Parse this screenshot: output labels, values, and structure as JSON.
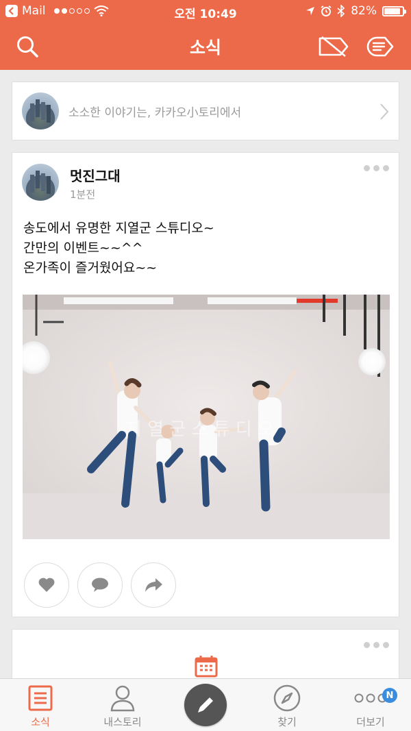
{
  "status_bar": {
    "back_app": "Mail",
    "time": "오전 10:49",
    "battery": "82%",
    "battery_level": 0.82
  },
  "header": {
    "title": "소식"
  },
  "compose": {
    "prompt": "소소한 이야기는, 카카오小토리에서"
  },
  "post": {
    "author": "멋진그대",
    "time": "1분전",
    "lines": [
      "송도에서 유명한 지열군 스튜디오~",
      "간만의 이벤트~~^^",
      "온가족이 즐거웠어요~~"
    ],
    "photo_watermark": "지 열 군 스 튜 디 오"
  },
  "tabbar": {
    "tabs": [
      {
        "label": "소식"
      },
      {
        "label": "내스토리"
      },
      {
        "label": "찾기"
      },
      {
        "label": "더보기"
      }
    ],
    "badge": "N"
  },
  "colors": {
    "accent": "#ec6a4a",
    "badge": "#3a8dde"
  }
}
